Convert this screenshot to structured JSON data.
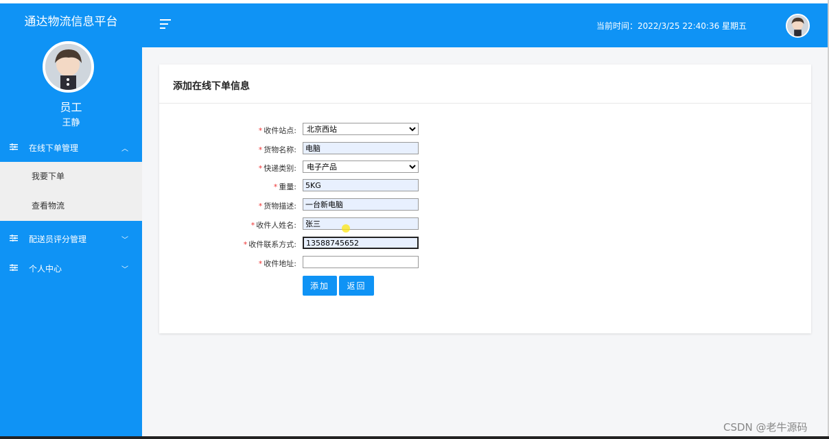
{
  "app": {
    "title": "通达物流信息平台"
  },
  "user": {
    "role": "员工",
    "name": "王静"
  },
  "sidebar": {
    "groups": [
      {
        "label": "在线下单管理",
        "expanded": true,
        "items": [
          {
            "label": "我要下单"
          },
          {
            "label": "查看物流"
          }
        ]
      },
      {
        "label": "配送员评分管理",
        "expanded": false
      },
      {
        "label": "个人中心",
        "expanded": false
      }
    ]
  },
  "header": {
    "clock": "当前时间：2022/3/25 22:40:36 星期五"
  },
  "form": {
    "title": "添加在线下单信息",
    "fields": [
      {
        "label": "收件站点",
        "type": "select",
        "value": "北京西站"
      },
      {
        "label": "货物名称",
        "type": "input",
        "value": "电脑"
      },
      {
        "label": "快递类别",
        "type": "select",
        "value": "电子产品"
      },
      {
        "label": "重量",
        "type": "input",
        "value": "5KG"
      },
      {
        "label": "货物描述",
        "type": "input",
        "value": "一台新电脑"
      },
      {
        "label": "收件人姓名",
        "type": "input",
        "value": "张三"
      },
      {
        "label": "收件联系方式",
        "type": "input",
        "value": "13588745652"
      },
      {
        "label": "收件地址",
        "type": "input",
        "value": ""
      }
    ],
    "add_label": "添加",
    "back_label": "返回"
  },
  "watermark": "CSDN @老牛源码",
  "colors": {
    "primary": "#0f93f5",
    "required": "#ee3333",
    "autofill": "#e8f0fe"
  }
}
